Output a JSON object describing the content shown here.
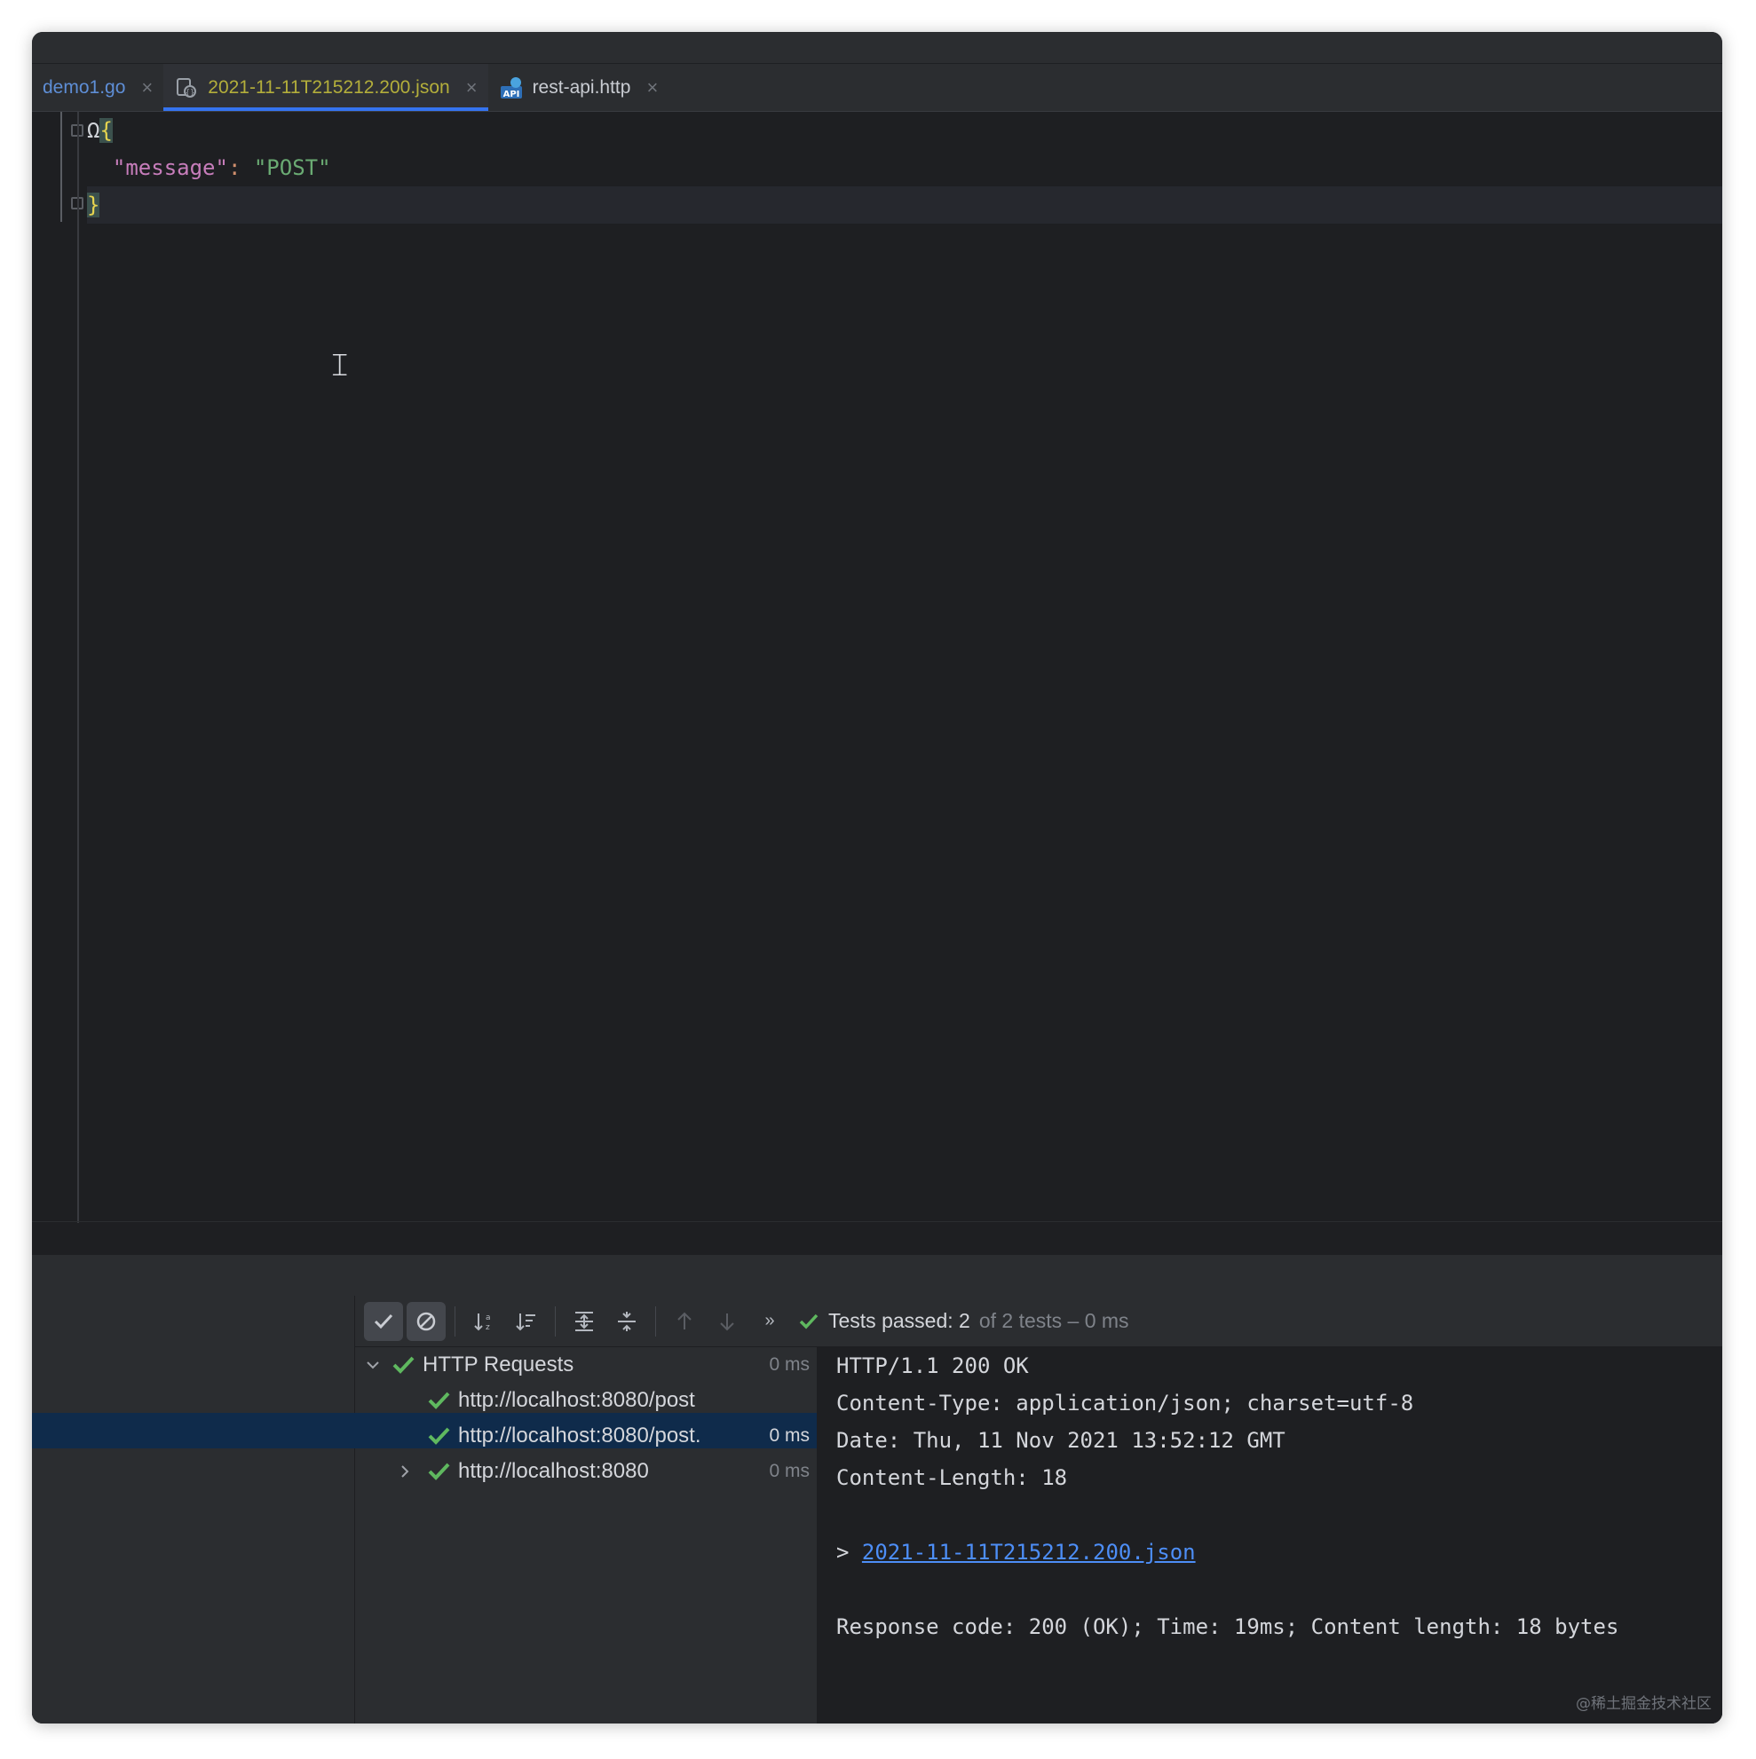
{
  "tabs": [
    {
      "label": "demo1.go",
      "icon": "go-file-icon",
      "active": false
    },
    {
      "label": "2021-11-11T215212.200.json",
      "icon": "json-response-icon",
      "active": true
    },
    {
      "label": "rest-api.http",
      "icon": "http-api-icon",
      "active": false
    }
  ],
  "editor": {
    "lines": [
      {
        "omega": "Ω",
        "open": "{"
      },
      {
        "indent": "  ",
        "key": "\"message\"",
        "colon": ":",
        "value": "\"POST\""
      },
      {
        "close": "}"
      }
    ]
  },
  "toolbar": {
    "status_passed": "Tests passed: 2",
    "status_rest": "of 2 tests – 0 ms"
  },
  "tree": {
    "root": {
      "label": "HTTP Requests",
      "time": "0 ms"
    },
    "items": [
      {
        "label": "http://localhost:8080/post",
        "time": ""
      },
      {
        "label": "http://localhost:8080/post.",
        "time": "0 ms"
      },
      {
        "label": "http://localhost:8080",
        "time": "0 ms"
      }
    ]
  },
  "console": {
    "status_line": "HTTP/1.1 200 OK",
    "content_type": "Content-Type: application/json; charset=utf-8",
    "date": "Date: Thu, 11 Nov 2021 13:52:12 GMT",
    "content_length": "Content-Length: 18",
    "prompt": "> ",
    "link": "2021-11-11T215212.200.json",
    "summary": "Response code: 200 (OK); Time: 19ms; Content length: 18 bytes"
  },
  "watermark": "@稀土掘金技术社区",
  "colors": {
    "accent": "#3574f0",
    "pass_green": "#5fb85f",
    "link": "#4d8ef7"
  }
}
